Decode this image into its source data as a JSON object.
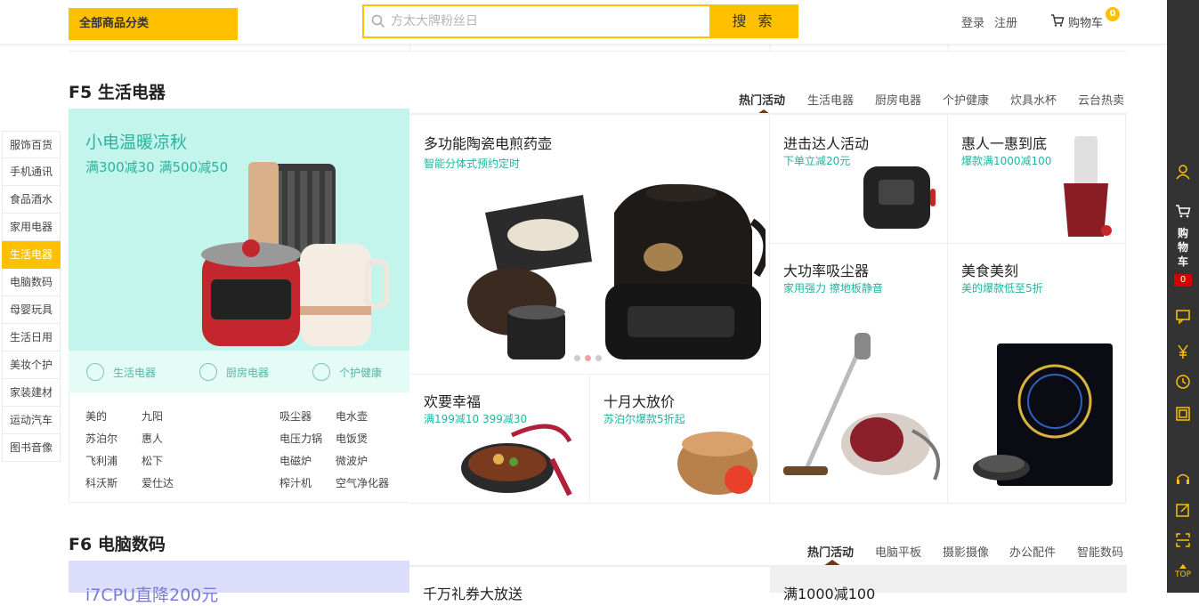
{
  "header": {
    "category_button": "全部商品分类",
    "search_placeholder": "方太大牌粉丝日",
    "search_button": "搜 索",
    "login": "登录",
    "register": "注册",
    "cart_label": "购物车",
    "cart_count": "0"
  },
  "floor_nav": [
    "服饰百货",
    "手机通讯",
    "食品酒水",
    "家用电器",
    "生活电器",
    "电脑数码",
    "母婴玩具",
    "生活日用",
    "美妆个护",
    "家装建材",
    "运动汽车",
    "图书音像"
  ],
  "f5": {
    "title": "F5 生活电器",
    "tabs": [
      "热门活动",
      "生活电器",
      "厨房电器",
      "个护健康",
      "炊具水杯",
      "云台热卖"
    ],
    "promo": {
      "title": "小电温暖凉秋",
      "subtitle": "满300减30 满500减50",
      "bar": [
        "生活电器",
        "厨房电器",
        "个护健康"
      ]
    },
    "brands_left": [
      "美的",
      "九阳",
      "苏泊尔",
      "惠人",
      "飞利浦",
      "松下",
      "科沃斯",
      "爱仕达"
    ],
    "categories_right": [
      "吸尘器",
      "电水壶",
      "电压力锅",
      "电饭煲",
      "电磁炉",
      "微波炉",
      "榨汁机",
      "空气净化器"
    ],
    "cells": {
      "center": {
        "title": "多功能陶瓷电煎药壶",
        "sub": "智能分体式预约定时"
      },
      "c1": {
        "title": "进击达人活动",
        "sub": "下单立减20元"
      },
      "c2": {
        "title": "惠人一惠到底",
        "sub": "爆款满1000减100"
      },
      "c3": {
        "title": "大功率吸尘器",
        "sub": "家用强力 擦地板静音"
      },
      "c4": {
        "title": "美食美刻",
        "sub": "美的爆款低至5折"
      },
      "c5": {
        "title": "欢要幸福",
        "sub": "满199减10 399减30"
      },
      "c6": {
        "title": "十月大放价",
        "sub": "苏泊尔爆款5折起"
      }
    }
  },
  "f6": {
    "title": "F6 电脑数码",
    "tabs": [
      "热门活动",
      "电脑平板",
      "摄影摄像",
      "办公配件",
      "智能数码"
    ],
    "promo_title": "i7CPU直降200元",
    "cell1_title": "千万礼券大放送",
    "cell2_title": "满1000减100"
  },
  "sidebar": {
    "cart_text": "购物车",
    "cart_badge": "0",
    "top_label": "TOP"
  },
  "colors": {
    "accent": "#ffc000",
    "teal": "#21b4a0",
    "sidebar": "#333333"
  }
}
